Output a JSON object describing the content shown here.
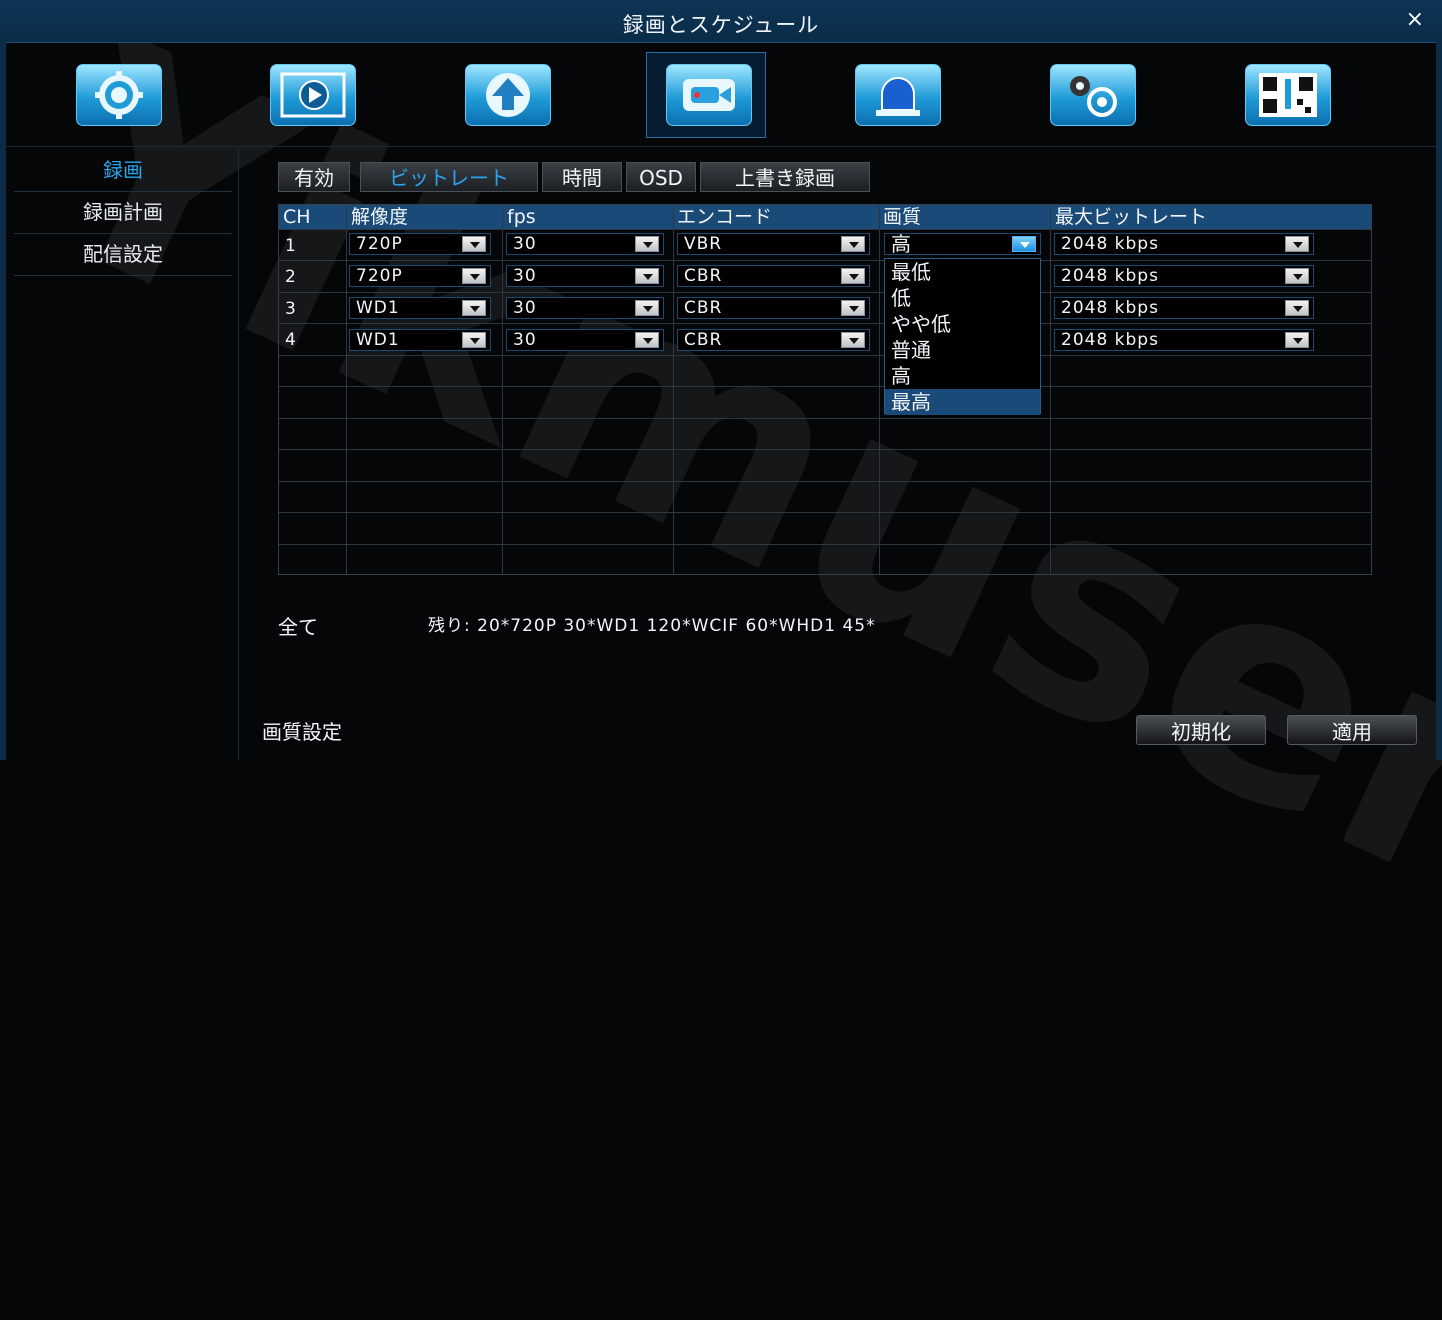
{
  "window": {
    "title": "録画とスケジュール",
    "close_glyph": "×"
  },
  "toolbar": {
    "icons": [
      "settings-icon",
      "playback-icon",
      "upload-icon",
      "camera-icon",
      "alarm-icon",
      "advanced-settings-icon",
      "qr-info-icon"
    ],
    "selected": "camera-icon"
  },
  "sidebar": {
    "items": [
      {
        "label": "録画",
        "active": true
      },
      {
        "label": "録画計画"
      },
      {
        "label": "配信設定"
      }
    ]
  },
  "tabs": [
    {
      "label": "有効"
    },
    {
      "label": "ビットレート",
      "active": true
    },
    {
      "label": "時間"
    },
    {
      "label": "OSD"
    },
    {
      "label": "上書き録画"
    }
  ],
  "table": {
    "headers": [
      "CH",
      "解像度",
      "fps",
      "エンコード",
      "画質",
      "最大ビットレート"
    ],
    "rows": [
      {
        "ch": "1",
        "resolution": "720P",
        "fps": "30",
        "encode": "VBR",
        "quality": "高",
        "bitrate": "2048 kbps"
      },
      {
        "ch": "2",
        "resolution": "720P",
        "fps": "30",
        "encode": "CBR",
        "quality": "",
        "bitrate": "2048 kbps"
      },
      {
        "ch": "3",
        "resolution": "WD1",
        "fps": "30",
        "encode": "CBR",
        "quality": "",
        "bitrate": "2048 kbps"
      },
      {
        "ch": "4",
        "resolution": "WD1",
        "fps": "30",
        "encode": "CBR",
        "quality": "",
        "bitrate": "2048 kbps"
      }
    ]
  },
  "quality_dropdown": {
    "options": [
      "最低",
      "低",
      "やや低",
      "普通",
      "高",
      "最高"
    ],
    "highlighted": "最高"
  },
  "all_label": "全て",
  "remaining": "残り: 20*720P 30*WD1 120*WCIF 60*WHD1 45*",
  "footer": {
    "label": "画質設定",
    "reset_button": "初期化",
    "apply_button": "適用"
  },
  "watermark": "Yikmusen",
  "colors": {
    "accent": "#28a8ee",
    "header_bg": "#1a4b78",
    "title_bg": "#0d3556"
  }
}
